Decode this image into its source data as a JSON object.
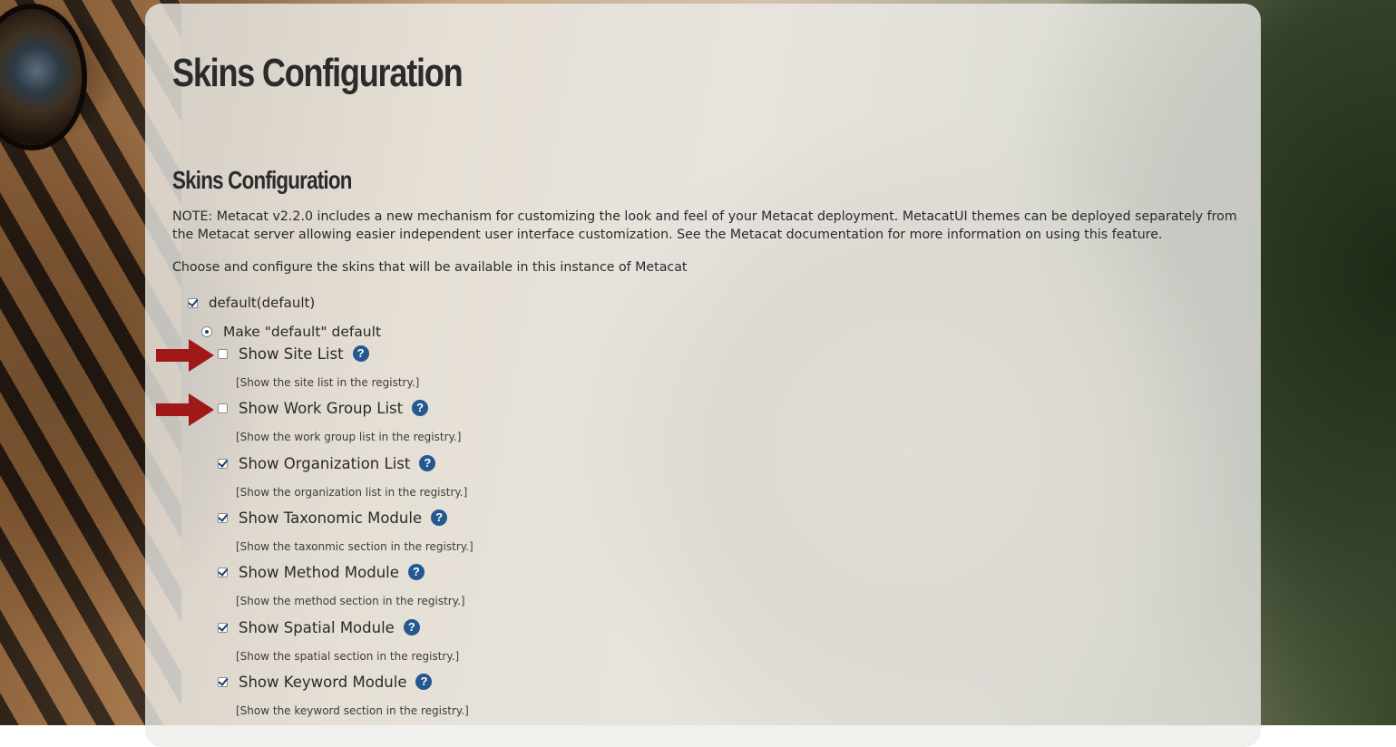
{
  "page": {
    "title": "Skins Configuration"
  },
  "section": {
    "title": "Skins Configuration",
    "note": "NOTE: Metacat v2.2.0 includes a new mechanism for customizing the look and feel of your Metacat deployment. MetacatUI themes can be deployed separately from the Metacat server allowing easier independent user interface customization. See the Metacat documentation for more information on using this feature.",
    "choose_text": "Choose and configure the skins that will be available in this instance of Metacat"
  },
  "skin": {
    "name": "default",
    "suffix": "(default)",
    "checked": true,
    "default_radio_label": "Make \"default\" default"
  },
  "options": [
    {
      "label": "Show Site List",
      "description": "[Show the site list in the registry.]",
      "checked": false,
      "highlighted": true
    },
    {
      "label": "Show Work Group List",
      "description": "[Show the work group list in the registry.]",
      "checked": false,
      "highlighted": true
    },
    {
      "label": "Show Organization List",
      "description": "[Show the organization list in the registry.]",
      "checked": true,
      "highlighted": false
    },
    {
      "label": "Show Taxonomic Module",
      "description": "[Show the taxonmic section in the registry.]",
      "checked": true,
      "highlighted": false
    },
    {
      "label": "Show Method Module",
      "description": "[Show the method section in the registry.]",
      "checked": true,
      "highlighted": false
    },
    {
      "label": "Show Spatial Module",
      "description": "[Show the spatial section in the registry.]",
      "checked": true,
      "highlighted": false
    },
    {
      "label": "Show Keyword Module",
      "description": "[Show the keyword section in the registry.]",
      "checked": true,
      "highlighted": false
    }
  ],
  "help_icon_text": "?",
  "colors": {
    "help_icon": "#24588f",
    "arrow": "#a01818",
    "checkmark": "#1a3f72"
  }
}
